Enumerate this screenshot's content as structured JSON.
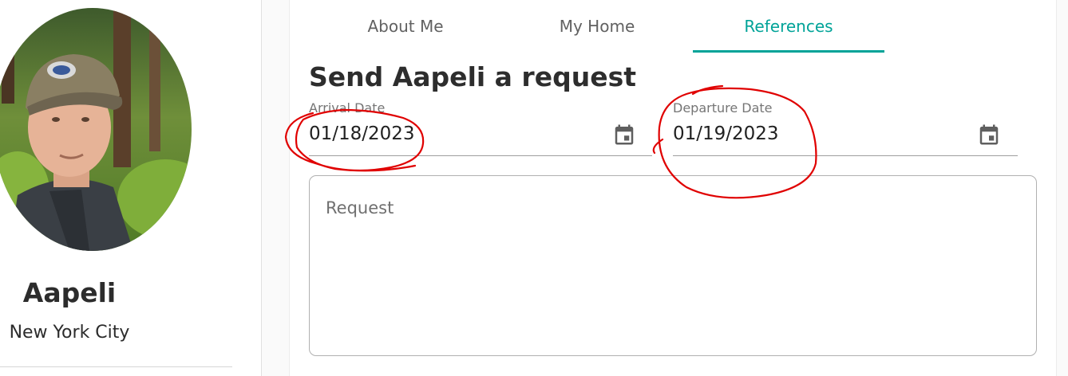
{
  "profile": {
    "name": "Aapeli",
    "city": "New York City"
  },
  "tabs": [
    {
      "label": "About Me",
      "active": false
    },
    {
      "label": "My Home",
      "active": false
    },
    {
      "label": "References",
      "active": true
    }
  ],
  "request_form": {
    "title": "Send Aapeli a request",
    "arrival": {
      "label": "Arrival Date",
      "value": "01/18/2023"
    },
    "departure": {
      "label": "Departure Date",
      "value": "01/19/2023"
    },
    "request_placeholder": "Request"
  },
  "colors": {
    "accent": "#00a398",
    "annotation": "#e00000"
  },
  "icons": {
    "calendar": "calendar-icon"
  }
}
